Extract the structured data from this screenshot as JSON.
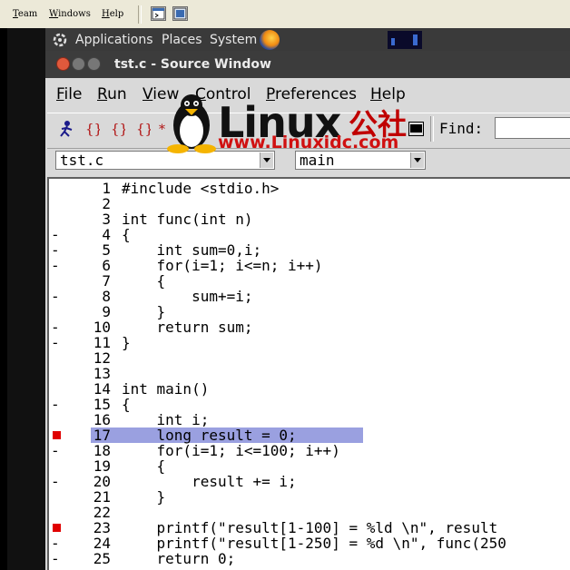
{
  "outer_menu": [
    {
      "first": "T",
      "rest": "eam"
    },
    {
      "first": "W",
      "rest": "indows"
    },
    {
      "first": "H",
      "rest": "elp"
    }
  ],
  "gnome_panel": {
    "items": [
      "Applications",
      "Places",
      "System"
    ]
  },
  "window": {
    "title": "tst.c - Source Window"
  },
  "app_menu": [
    {
      "first": "F",
      "rest": "ile"
    },
    {
      "first": "R",
      "rest": "un"
    },
    {
      "first": "V",
      "rest": "iew"
    },
    {
      "first": "C",
      "rest": "ontrol"
    },
    {
      "first": "P",
      "rest": "references"
    },
    {
      "first": "H",
      "rest": "elp"
    }
  ],
  "toolbar": {
    "find_label": "Find:",
    "find_value": ""
  },
  "combos": {
    "file": "tst.c",
    "function": "main"
  },
  "logo": {
    "word": "Linux",
    "cn": "公社",
    "url": "www.Linuxidc.com"
  },
  "source_lines": [
    {
      "num": "1",
      "mark": "",
      "code": "#include <stdio.h>"
    },
    {
      "num": "2",
      "mark": "",
      "code": ""
    },
    {
      "num": "3",
      "mark": "",
      "code": "int func(int n)"
    },
    {
      "num": "4",
      "mark": "-",
      "code": "{"
    },
    {
      "num": "5",
      "mark": "-",
      "code": "    int sum=0,i;"
    },
    {
      "num": "6",
      "mark": "-",
      "code": "    for(i=1; i<=n; i++)"
    },
    {
      "num": "7",
      "mark": "",
      "code": "    {"
    },
    {
      "num": "8",
      "mark": "-",
      "code": "        sum+=i;"
    },
    {
      "num": "9",
      "mark": "",
      "code": "    }"
    },
    {
      "num": "10",
      "mark": "-",
      "code": "    return sum;"
    },
    {
      "num": "11",
      "mark": "-",
      "code": "}"
    },
    {
      "num": "12",
      "mark": "",
      "code": ""
    },
    {
      "num": "13",
      "mark": "",
      "code": ""
    },
    {
      "num": "14",
      "mark": "",
      "code": "int main()"
    },
    {
      "num": "15",
      "mark": "-",
      "code": "{"
    },
    {
      "num": "16",
      "mark": "",
      "code": "    int i;"
    },
    {
      "num": "17",
      "mark": "bp",
      "code": "    long result = 0;",
      "highlight": true
    },
    {
      "num": "18",
      "mark": "-",
      "code": "    for(i=1; i<=100; i++)"
    },
    {
      "num": "19",
      "mark": "",
      "code": "    {"
    },
    {
      "num": "20",
      "mark": "-",
      "code": "        result += i;"
    },
    {
      "num": "21",
      "mark": "",
      "code": "    }"
    },
    {
      "num": "22",
      "mark": "",
      "code": ""
    },
    {
      "num": "23",
      "mark": "bp",
      "code": "    printf(\"result[1-100] = %ld \\n\", result"
    },
    {
      "num": "24",
      "mark": "-",
      "code": "    printf(\"result[1-250] = %d \\n\", func(250"
    },
    {
      "num": "25",
      "mark": "-",
      "code": "    return 0;"
    }
  ],
  "colors": {
    "highlight": "#9aa0e0",
    "breakpoint": "#e00000",
    "logo_red": "#d01010"
  }
}
